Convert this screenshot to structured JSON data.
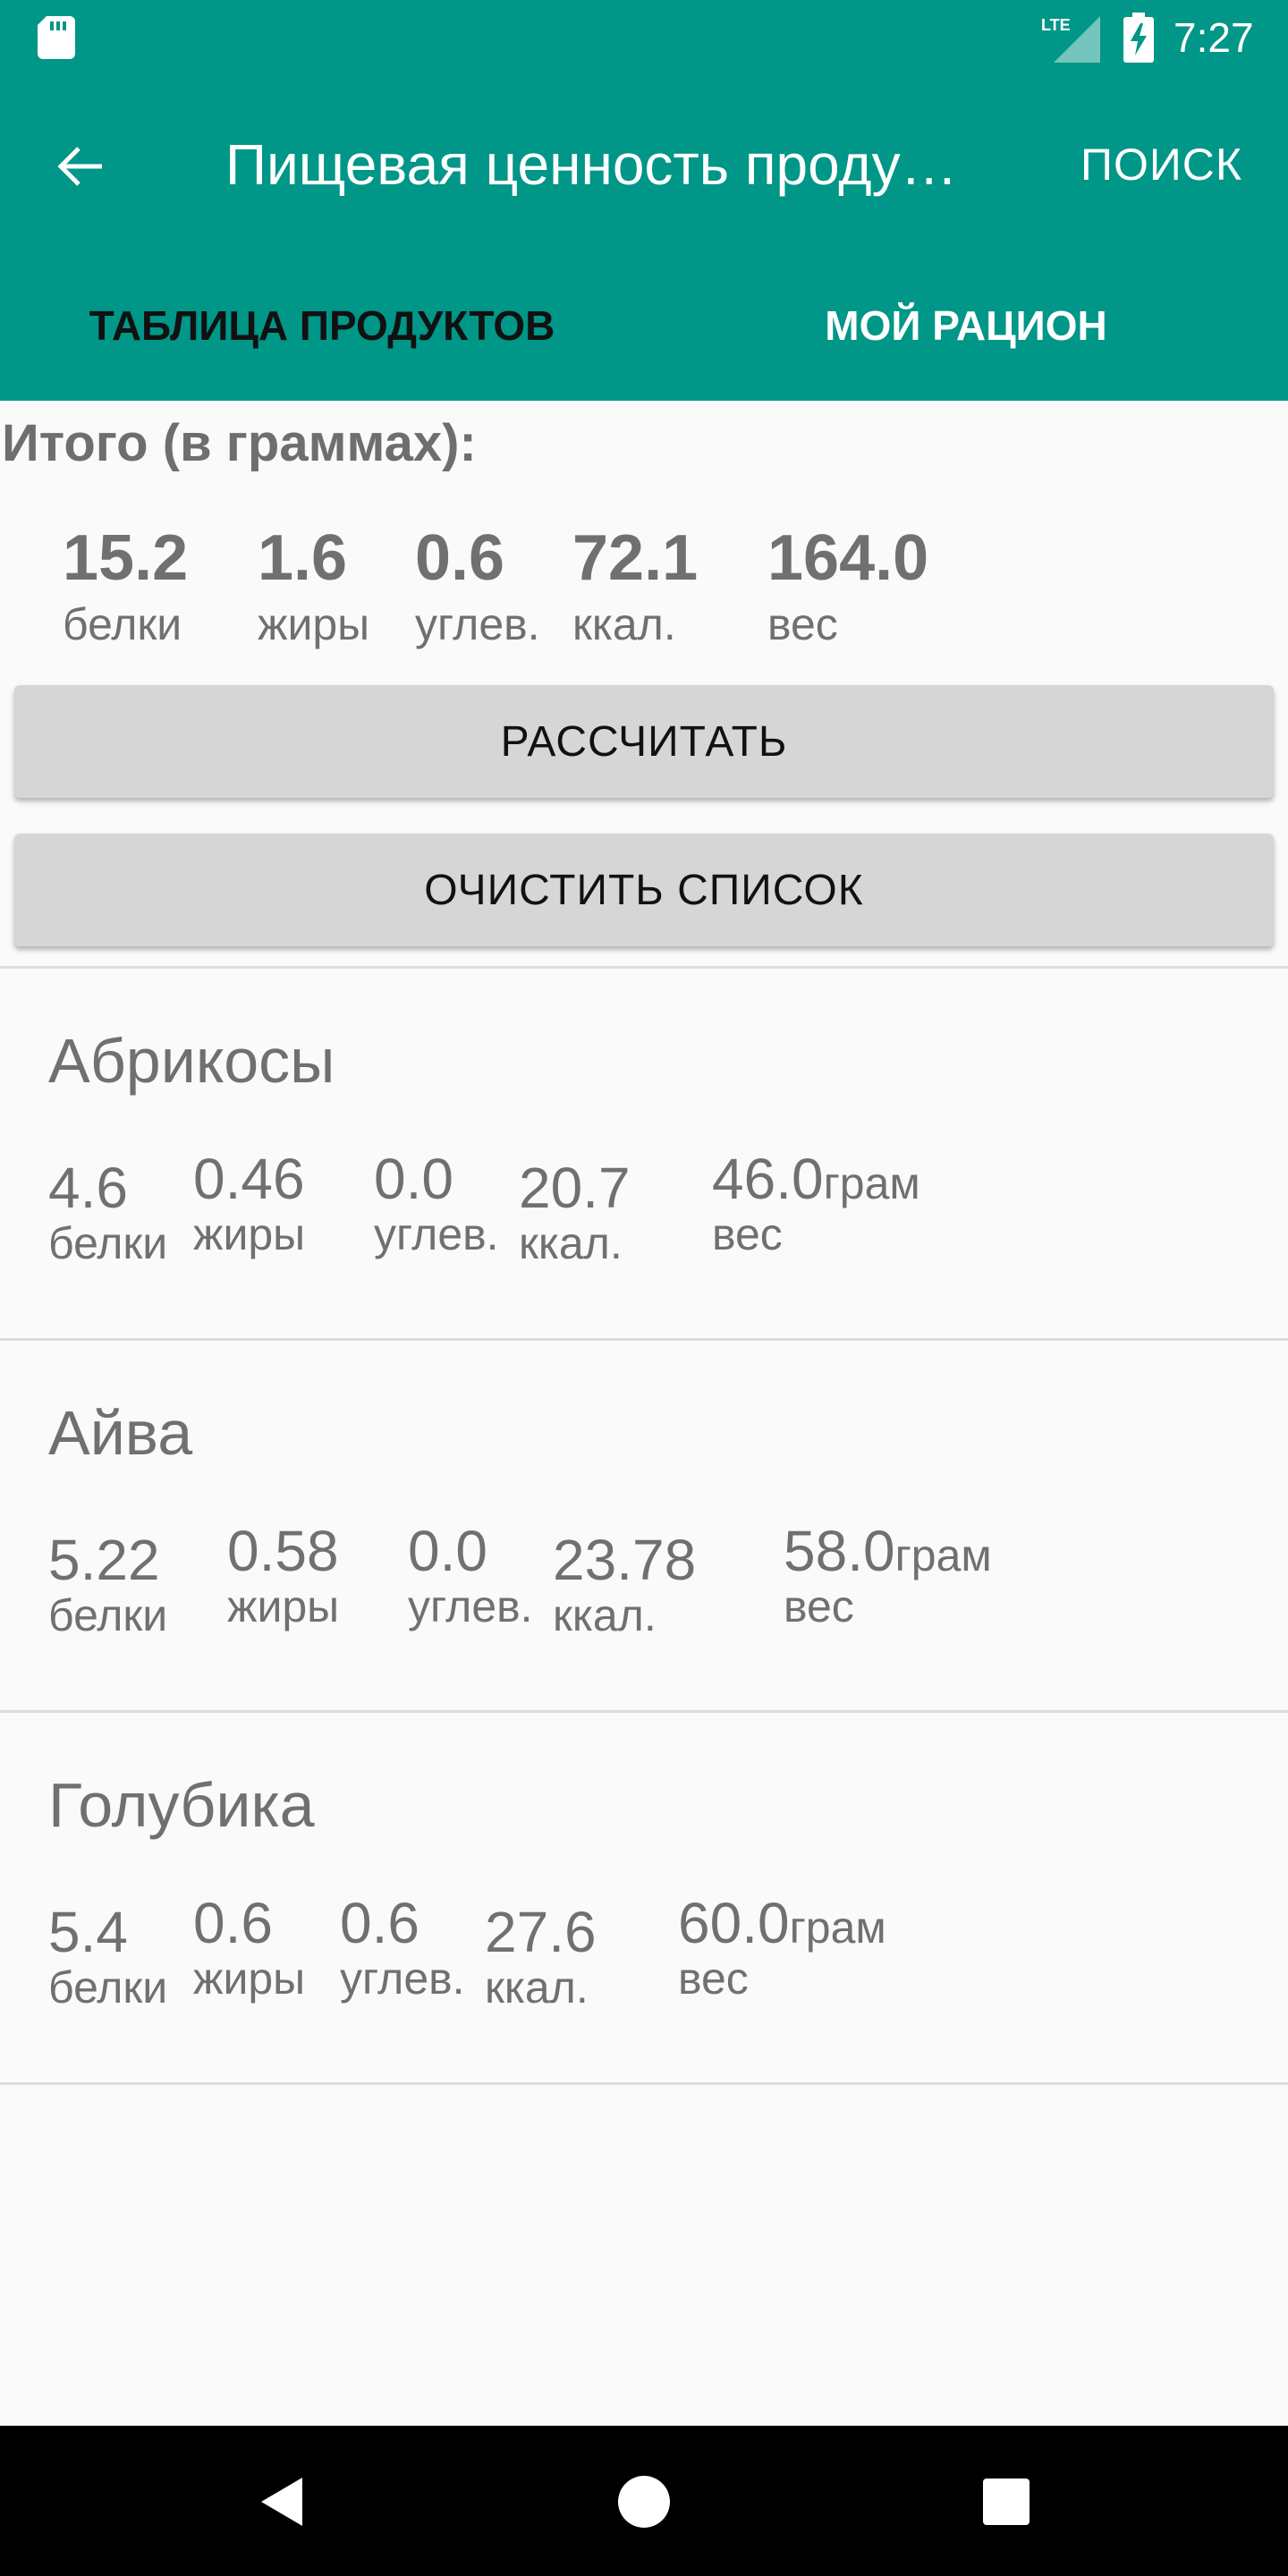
{
  "status_bar": {
    "time": "7:27",
    "network": "LTE"
  },
  "toolbar": {
    "title": "Пищевая ценность проду…",
    "search_label": "ПОИСК"
  },
  "tabs": [
    {
      "label": "ТАБЛИЦА ПРОДУКТОВ"
    },
    {
      "label": "МОЙ РАЦИОН"
    }
  ],
  "totals": {
    "heading": "Итого (в граммах):",
    "metrics": [
      {
        "value": "15.2",
        "label": "белки"
      },
      {
        "value": "1.6",
        "label": "жиры"
      },
      {
        "value": "0.6",
        "label": "углев."
      },
      {
        "value": "72.1",
        "label": "ккал."
      },
      {
        "value": "164.0",
        "label": "вес"
      }
    ]
  },
  "buttons": {
    "calculate": "РАССЧИТАТЬ",
    "clear": "ОЧИСТИТЬ СПИСОК"
  },
  "products": [
    {
      "name": "Абрикосы",
      "protein": "4.6",
      "fat": "0.46",
      "carbs": "0.0",
      "kcal": "20.7",
      "weight": "46.0",
      "weight_unit": "грам",
      "labels": {
        "protein": "белки",
        "fat": "жиры",
        "carbs": "углев.",
        "kcal": "ккал.",
        "weight": "вес"
      }
    },
    {
      "name": "Айва",
      "protein": "5.22",
      "fat": "0.58",
      "carbs": "0.0",
      "kcal": "23.78",
      "weight": "58.0",
      "weight_unit": "грам",
      "labels": {
        "protein": "белки",
        "fat": "жиры",
        "carbs": "углев.",
        "kcal": "ккал.",
        "weight": "вес"
      }
    },
    {
      "name": "Голубика",
      "protein": "5.4",
      "fat": "0.6",
      "carbs": "0.6",
      "kcal": "27.6",
      "weight": "60.0",
      "weight_unit": "грам",
      "labels": {
        "protein": "белки",
        "fat": "жиры",
        "carbs": "углев.",
        "kcal": "ккал.",
        "weight": "вес"
      }
    }
  ],
  "colors": {
    "primary": "#009688",
    "text_gray": "#707070",
    "button_bg": "#d6d6d6"
  },
  "icons": {
    "back": "arrow-left-icon",
    "sd": "sd-card-icon",
    "signal": "lte-signal-icon",
    "battery": "battery-charging-icon",
    "nav_back": "triangle-back-icon",
    "nav_home": "circle-home-icon",
    "nav_recents": "square-recents-icon"
  }
}
